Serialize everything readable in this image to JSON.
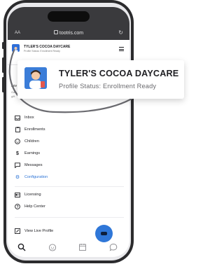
{
  "browser": {
    "text_size_label": "AA",
    "url": "tootris.com",
    "reload_icon": "reload-icon"
  },
  "app_header": {
    "title": "TYLER'S COCOA DAYCARE",
    "status": "Profile Status: Enrollment Ready"
  },
  "peek": {
    "line1": "Lov",
    "line2": "Gar",
    "line3": "gift"
  },
  "menu": {
    "items": [
      {
        "label": "Inbox",
        "icon": "inbox-icon"
      },
      {
        "label": "Enrollments",
        "icon": "clipboard-icon"
      },
      {
        "label": "Children",
        "icon": "child-face-icon"
      },
      {
        "label": "Earnings",
        "icon": "dollar-icon"
      },
      {
        "label": "Messages",
        "icon": "chat-icon"
      },
      {
        "label": "Configuration",
        "icon": "gear-icon",
        "active": true
      },
      {
        "label": "Licensing",
        "icon": "license-card-icon"
      },
      {
        "label": "Help Center",
        "icon": "help-icon"
      },
      {
        "label": "View Live Profile",
        "icon": "external-link-icon"
      }
    ]
  },
  "callout": {
    "title": "TYLER'S COCOA DAYCARE",
    "status": "Profile Status: Enrollment Ready"
  },
  "colors": {
    "accent": "#2d74d6",
    "frame": "#2b2b2d",
    "browser_bar": "#3a3a3d"
  }
}
